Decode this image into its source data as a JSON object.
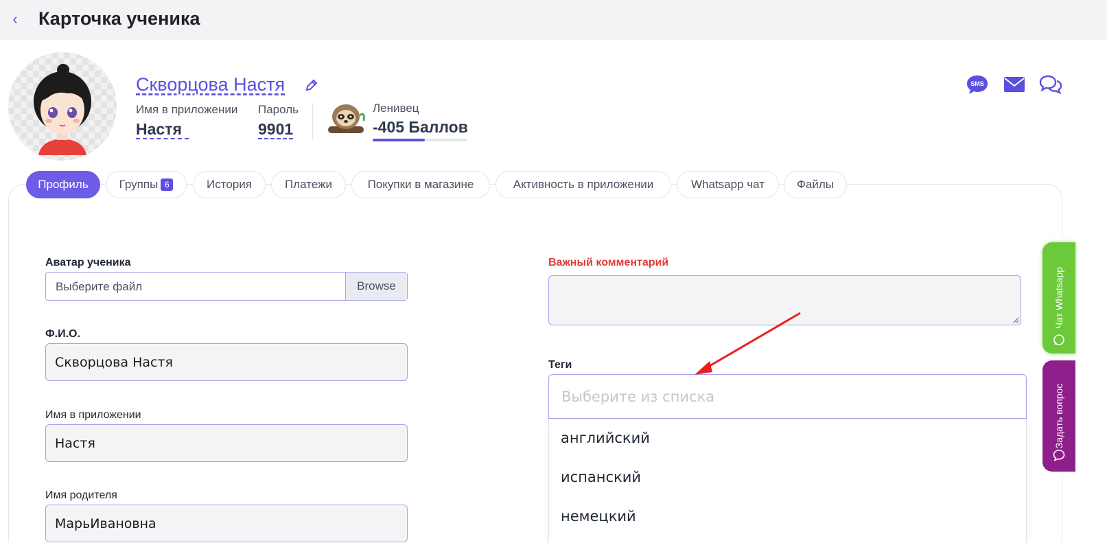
{
  "header": {
    "title": "Карточка ученика"
  },
  "student": {
    "full_name": "Скворцова Настя",
    "app_name_label": "Имя в приложении",
    "app_name": "Настя",
    "password_label": "Пароль",
    "password": "9901",
    "level_title": "Ленивец",
    "points": "-405 Баллов",
    "level_progress": 0.55
  },
  "tabs": [
    {
      "label": "Профиль"
    },
    {
      "label": "Группы",
      "badge": "6"
    },
    {
      "label": "История"
    },
    {
      "label": "Платежи"
    },
    {
      "label": "Покупки в магазине"
    },
    {
      "label": "Активность в приложении"
    },
    {
      "label": "Whatsapp чат"
    },
    {
      "label": "Файлы"
    }
  ],
  "form": {
    "avatar_label": "Аватар ученика",
    "file_placeholder": "Выберите файл",
    "browse_label": "Browse",
    "fio_label": "Ф.И.О.",
    "fio_value": "Скворцова Настя",
    "app_name_label": "Имя в приложении",
    "app_name_value": "Настя",
    "parent_name_label": "Имя родителя",
    "parent_name_value": "МарьИвановна",
    "important_comment_label": "Важный комментарий",
    "tags_label": "Теги",
    "tags_placeholder": "Выберите из списка",
    "tag_options": [
      "английский",
      "испанский",
      "немецкий"
    ]
  },
  "side_widgets": {
    "whatsapp_label": "Чат Whatsapp",
    "ask_label": "Задать вопрос"
  },
  "colors": {
    "accent": "#6c5ce7",
    "link": "#5b4fe0",
    "important": "#e03b3b",
    "whatsapp": "#6cc93c",
    "ask": "#8e1f8a"
  }
}
